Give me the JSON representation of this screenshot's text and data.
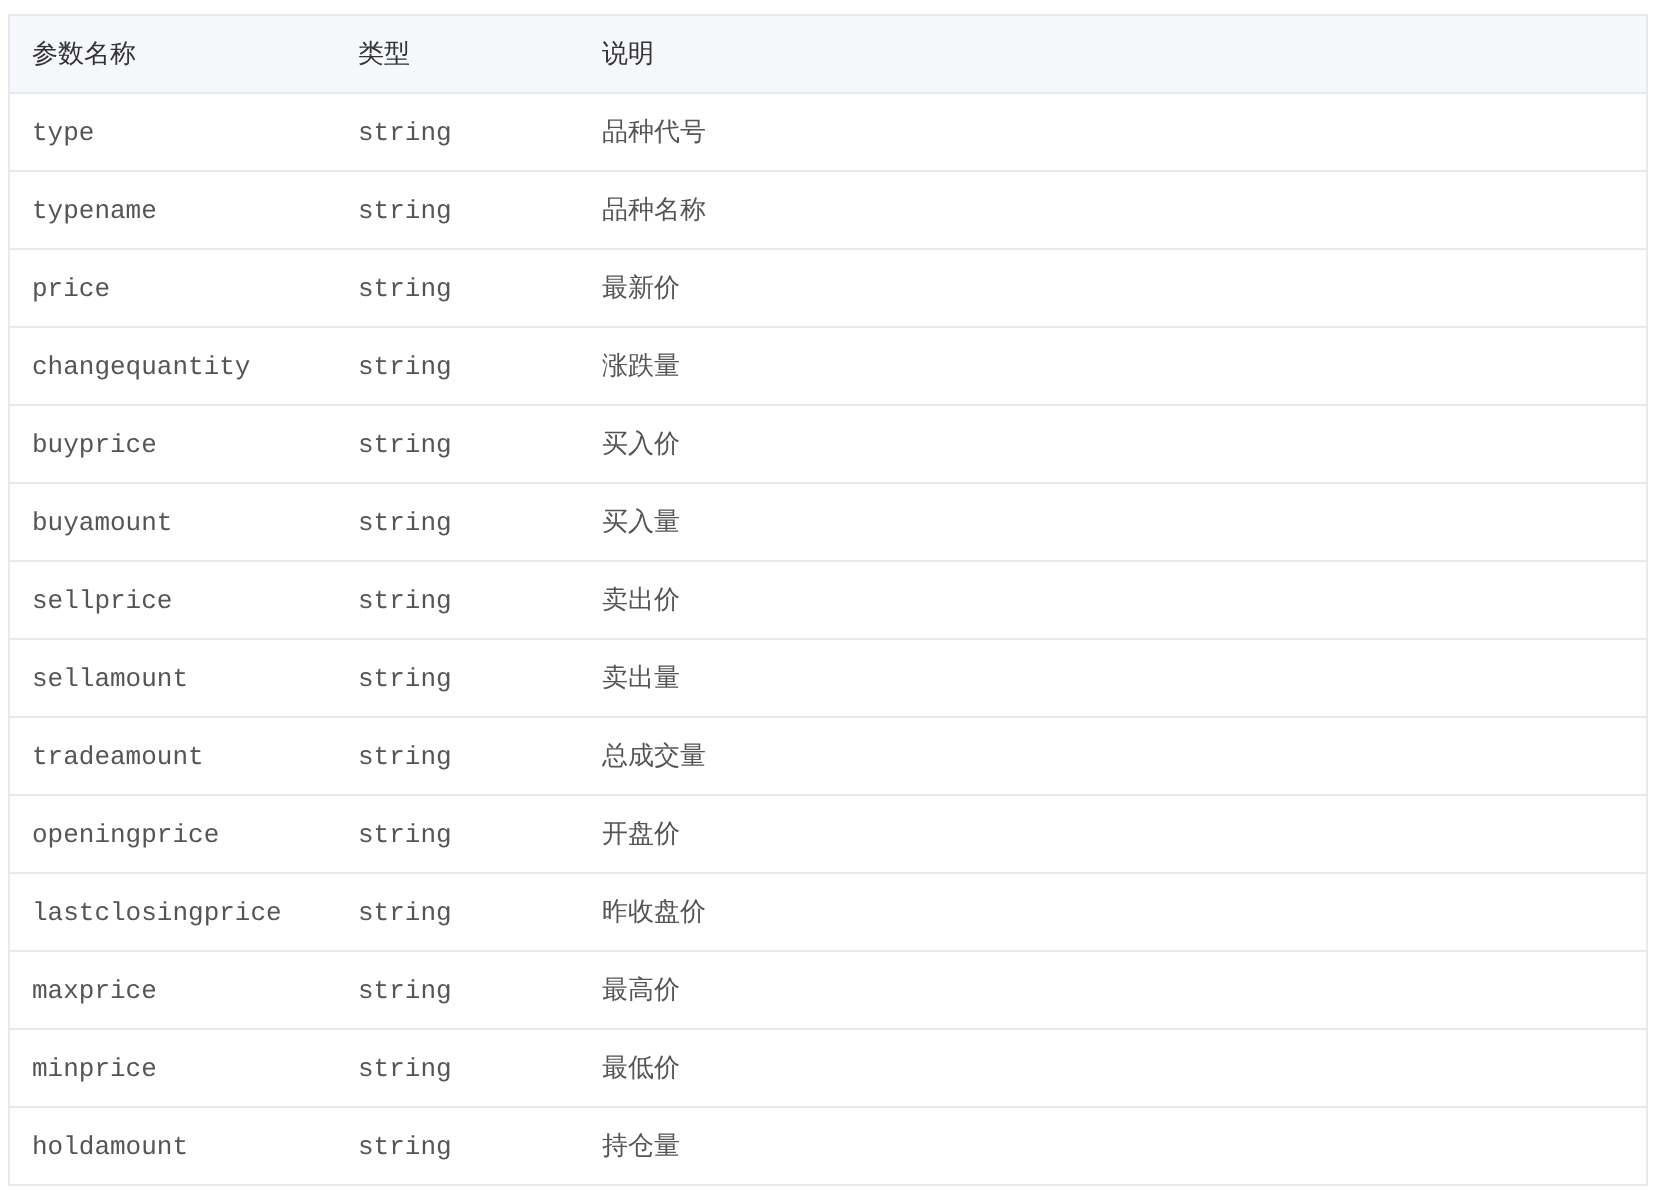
{
  "table": {
    "columns": [
      "参数名称",
      "类型",
      "说明"
    ],
    "rows": [
      [
        "type",
        "string",
        "品种代号"
      ],
      [
        "typename",
        "string",
        "品种名称"
      ],
      [
        "price",
        "string",
        "最新价"
      ],
      [
        "changequantity",
        "string",
        "涨跌量"
      ],
      [
        "buyprice",
        "string",
        "买入价"
      ],
      [
        "buyamount",
        "string",
        "买入量"
      ],
      [
        "sellprice",
        "string",
        "卖出价"
      ],
      [
        "sellamount",
        "string",
        "卖出量"
      ],
      [
        "tradeamount",
        "string",
        "总成交量"
      ],
      [
        "openingprice",
        "string",
        "开盘价"
      ],
      [
        "lastclosingprice",
        "string",
        "昨收盘价"
      ],
      [
        "maxprice",
        "string",
        "最高价"
      ],
      [
        "minprice",
        "string",
        "最低价"
      ],
      [
        "holdamount",
        "string",
        "持仓量"
      ]
    ]
  }
}
